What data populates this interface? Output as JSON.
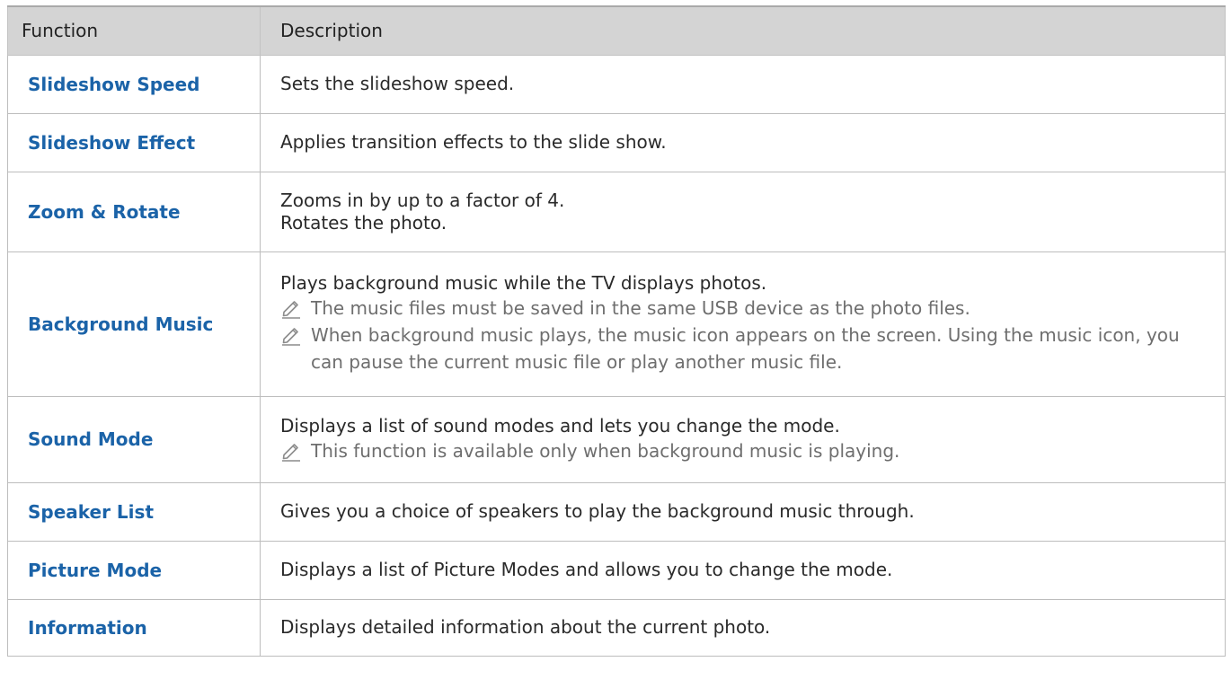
{
  "table": {
    "headers": [
      "Function",
      "Description"
    ],
    "rows": [
      {
        "function": "Slideshow Speed",
        "lines": [
          "Sets the slideshow speed."
        ],
        "notes": []
      },
      {
        "function": "Slideshow Effect",
        "lines": [
          "Applies transition effects to the slide show."
        ],
        "notes": []
      },
      {
        "function": "Zoom & Rotate",
        "lines": [
          "Zooms in by up to a factor of 4.",
          "Rotates the photo."
        ],
        "notes": []
      },
      {
        "function": "Background Music",
        "lines": [
          "Plays background music while the TV displays photos."
        ],
        "notes": [
          "The music files must be saved in the same USB device as the photo files.",
          "When background music plays, the music icon appears on the screen. Using the music icon, you can pause the current music file or play another music file."
        ]
      },
      {
        "function": "Sound Mode",
        "lines": [
          "Displays a list of sound modes and lets you change the mode."
        ],
        "notes": [
          "This function is available only when background music is playing."
        ]
      },
      {
        "function": "Speaker List",
        "lines": [
          "Gives you a choice of speakers to play the background music through."
        ],
        "notes": []
      },
      {
        "function": "Picture Mode",
        "lines": [
          "Displays a list of Picture Modes and allows you to change the mode."
        ],
        "notes": []
      },
      {
        "function": "Information",
        "lines": [
          "Displays detailed information about the current photo."
        ],
        "notes": []
      }
    ]
  },
  "icons": {
    "note": "pencil-note-icon"
  },
  "colors": {
    "function_name": "#1b63a8",
    "header_bg": "#d4d4d4",
    "note_text": "#6e6e6e"
  }
}
